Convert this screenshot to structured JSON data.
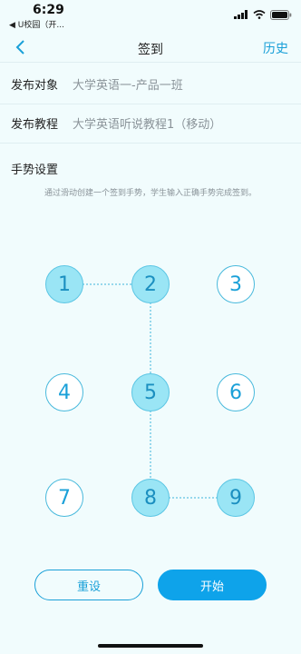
{
  "status": {
    "time": "6:29",
    "back_app": "◀ U校园（开..."
  },
  "nav": {
    "title": "签到",
    "right": "历史"
  },
  "form": {
    "target_label": "发布对象",
    "target_value": "大学英语一-产品一班",
    "course_label": "发布教程",
    "course_value": "大学英语听说教程1（移动）"
  },
  "gesture": {
    "title": "手势设置",
    "hint": "通过滑动创建一个签到手势，学生输入正确手势完成签到。",
    "dots": [
      {
        "label": "1",
        "selected": true
      },
      {
        "label": "2",
        "selected": true
      },
      {
        "label": "3",
        "selected": false
      },
      {
        "label": "4",
        "selected": false
      },
      {
        "label": "5",
        "selected": true
      },
      {
        "label": "6",
        "selected": false
      },
      {
        "label": "7",
        "selected": false
      },
      {
        "label": "8",
        "selected": true
      },
      {
        "label": "9",
        "selected": true
      }
    ],
    "path": [
      "1",
      "2",
      "5",
      "8",
      "9"
    ]
  },
  "buttons": {
    "reset": "重设",
    "start": "开始"
  },
  "colors": {
    "accent": "#1aa0d8",
    "selected_fill": "#9ae5f5",
    "start_fill": "#0ea3ea"
  }
}
